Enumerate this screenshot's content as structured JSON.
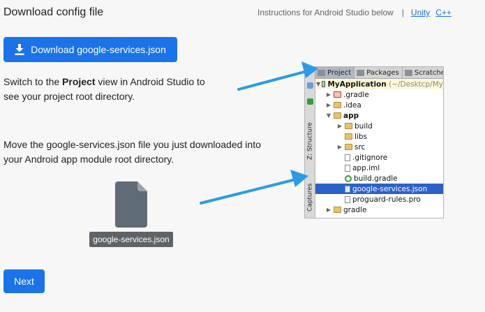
{
  "header": {
    "title": "Download config file",
    "instructions_text": "Instructions for Android Studio below",
    "separator": "|",
    "link_unity": "Unity",
    "link_cpp": "C++"
  },
  "download_button": {
    "label": "Download google-services.json",
    "icon": "download-icon"
  },
  "step1": {
    "prefix": "Switch to the ",
    "bold": "Project",
    "suffix": " view in Android Studio to see your project root directory."
  },
  "step2": {
    "text": "Move the google-services.json file you just downloaded into your Android app module root directory."
  },
  "file": {
    "icon": "file-icon",
    "name": "google-services.json"
  },
  "next_button": {
    "label": "Next"
  },
  "android_studio": {
    "tabs": [
      "Project",
      "Packages",
      "Scratches"
    ],
    "side_tabs": [
      "Z: Structure",
      "Captures"
    ],
    "tree": [
      {
        "label": "MyApplication",
        "extra": "(~/Desktcp/My",
        "icon": "folder-root-icon",
        "arrow": "▼"
      },
      {
        "label": ".gradle",
        "icon": "folder-icon",
        "arrow": "▶"
      },
      {
        "label": ".idea",
        "icon": "folder-icon",
        "arrow": "▶"
      },
      {
        "label": "app",
        "icon": "folder-icon",
        "arrow": "▼"
      },
      {
        "label": "build",
        "icon": "folder-icon",
        "arrow": "▶"
      },
      {
        "label": "libs",
        "icon": "folder-icon",
        "arrow": ""
      },
      {
        "label": "src",
        "icon": "folder-icon",
        "arrow": "▶"
      },
      {
        "label": ".gitignore",
        "icon": "file-icon",
        "arrow": ""
      },
      {
        "label": "app.iml",
        "icon": "file-icon",
        "arrow": ""
      },
      {
        "label": "build.gradle",
        "icon": "gradle-icon",
        "arrow": ""
      },
      {
        "label": "google-services.json",
        "icon": "json-file-icon",
        "arrow": ""
      },
      {
        "label": "proguard-rules.pro",
        "icon": "file-icon",
        "arrow": ""
      },
      {
        "label": "gradle",
        "icon": "folder-icon",
        "arrow": "▶"
      }
    ]
  },
  "colors": {
    "accent": "#1a73e8",
    "chip": "#5f6368",
    "file": "#5f6b75",
    "arrow": "#2b9be8",
    "selection": "#2b62c8"
  }
}
